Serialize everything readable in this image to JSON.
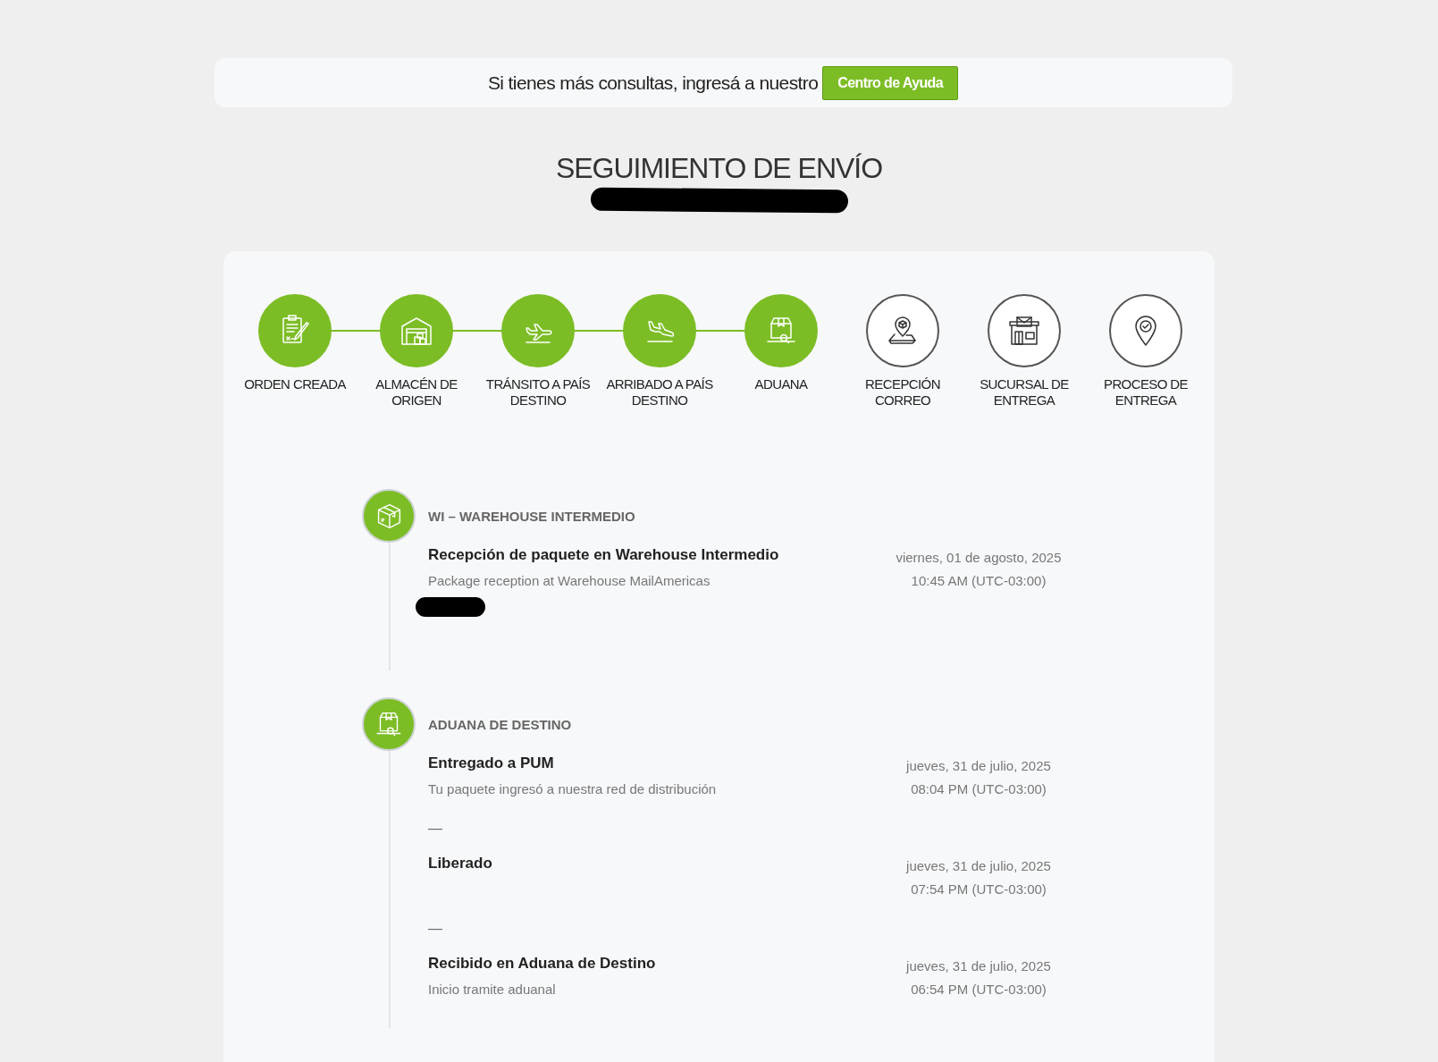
{
  "help_banner": {
    "text": "Si tienes más consultas, ingresá a nuestro",
    "button": "Centro de Ayuda"
  },
  "title": "SEGUIMIENTO DE ENVÍO",
  "steps": [
    {
      "label": "ORDEN CREADA",
      "completed": true
    },
    {
      "label": "ALMACÉN DE ORIGEN",
      "completed": true
    },
    {
      "label": "TRÁNSITO A PAÍS DESTINO",
      "completed": true
    },
    {
      "label": "ARRIBADO A PAÍS DESTINO",
      "completed": true
    },
    {
      "label": "ADUANA",
      "completed": true
    },
    {
      "label": "RECEPCIÓN CORREO",
      "completed": false
    },
    {
      "label": "SUCURSAL DE ENTREGA",
      "completed": false
    },
    {
      "label": "PROCESO DE ENTREGA",
      "completed": false
    }
  ],
  "timeline": [
    {
      "heading": "WI – WAREHOUSE INTERMEDIO",
      "kind": "box",
      "events": [
        {
          "title": "Recepción de paquete en Warehouse Intermedio",
          "description": "Package reception at Warehouse MailAmericas",
          "date": "viernes, 01 de agosto, 2025",
          "time": "10:45 AM (UTC-03:00)"
        }
      ]
    },
    {
      "heading": "ADUANA DE DESTINO",
      "kind": "customs",
      "events": [
        {
          "title": "Entregado a PUM",
          "description": "Tu paquete ingresó a nuestra red de distribución",
          "date": "jueves, 31 de julio, 2025",
          "time": "08:04 PM (UTC-03:00)"
        },
        {
          "separator": "—",
          "title": "Liberado",
          "date": "jueves, 31 de julio, 2025",
          "time": "07:54 PM (UTC-03:00)"
        },
        {
          "separator": "—",
          "title": "Recibido en Aduana de Destino",
          "description": "Inicio tramite aduanal",
          "date": "jueves, 31 de julio, 2025",
          "time": "06:54 PM (UTC-03:00)"
        }
      ]
    }
  ]
}
